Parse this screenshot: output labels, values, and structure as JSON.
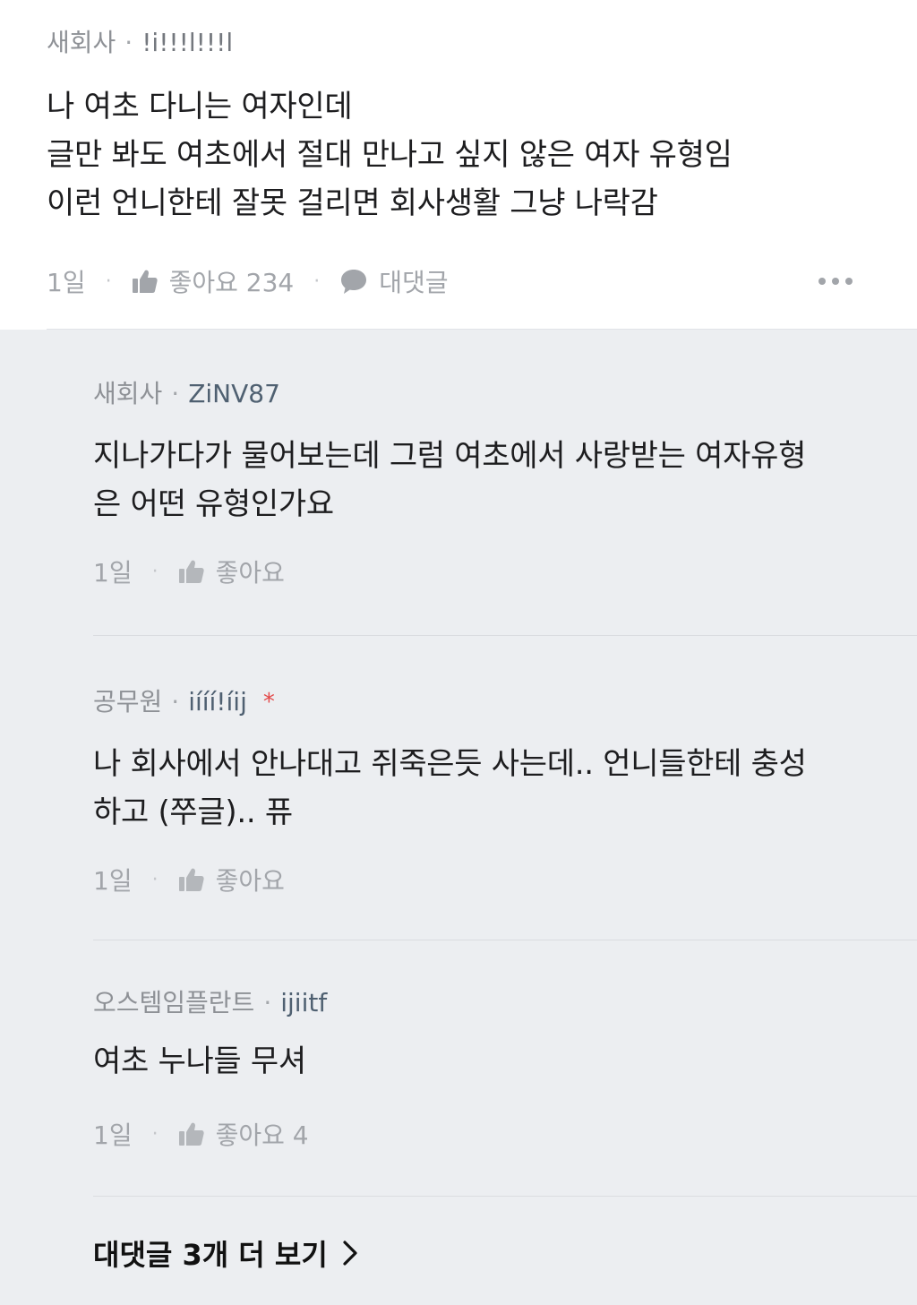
{
  "main_comment": {
    "company": "새회사",
    "separator": "·",
    "nickname": "!i!!!l!!!l",
    "lines": [
      "나 여초 다니는 여자인데",
      "글만 봐도 여초에서 절대 만나고 싶지 않은 여자 유형임",
      "이런 언니한테 잘못 걸리면 회사생활 그냥 나락감"
    ],
    "time": "1일",
    "like_label": "좋아요 234",
    "reply_label": "대댓글"
  },
  "replies": [
    {
      "company": "새회사",
      "separator": "·",
      "nickname": "ZiNV87",
      "lines": [
        "지나가다가 물어보는데 그럼 여초에서 사랑받는 여자유형",
        "은 어떤 유형인가요"
      ],
      "time": "1일",
      "like_label": "좋아요"
    },
    {
      "company": "공무원",
      "separator": "·",
      "nickname": "iííí!íij",
      "author_mark": "*",
      "lines": [
        "나 회사에서 안나대고 쥐죽은듯 사는데.. 언니들한테 충성",
        "하고 (쭈글).. 퓨"
      ],
      "time": "1일",
      "like_label": "좋아요"
    },
    {
      "company": "오스템임플란트",
      "separator": "·",
      "nickname": "ijiitf",
      "lines": [
        "여초 누나들 무셔"
      ],
      "time": "1일",
      "like_label": "좋아요 4"
    }
  ],
  "more_replies_label": "대댓글 3개 더 보기",
  "action_separator": "·",
  "icons": {
    "like": "thumbs-up-icon",
    "reply": "speech-bubble-icon",
    "more": "more-horizontal-icon",
    "chevron": "chevron-right-icon"
  }
}
